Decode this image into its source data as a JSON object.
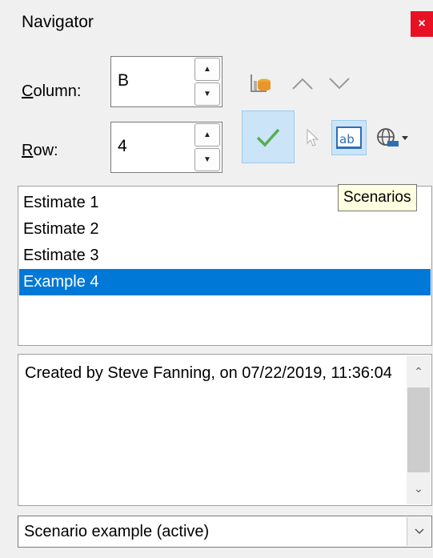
{
  "window": {
    "title": "Navigator",
    "close_glyph": "×"
  },
  "column": {
    "accel": "C",
    "label_rest": "olumn:",
    "value": "B"
  },
  "row": {
    "accel": "R",
    "label_rest": "ow:",
    "value": "4"
  },
  "toolbar": {
    "icons": [
      "data-ranges-icon",
      "previous-icon",
      "next-icon",
      "apply-icon",
      "drag-mode-icon",
      "scenarios-icon",
      "documents-icon",
      "dropdown-arrow-icon"
    ],
    "tooltip": "Scenarios"
  },
  "scenarios": {
    "items": [
      "Estimate 1",
      "Estimate 2",
      "Estimate 3",
      "Example 4"
    ],
    "selected_index": 3
  },
  "comment": {
    "text": "Created by Steve Fanning, on 07/22/2019, 11:36:04"
  },
  "document_select": {
    "value": "Scenario example (active)"
  },
  "colors": {
    "selection": "#0078d7",
    "active_tool": "#cce4f7",
    "close": "#e81123"
  }
}
